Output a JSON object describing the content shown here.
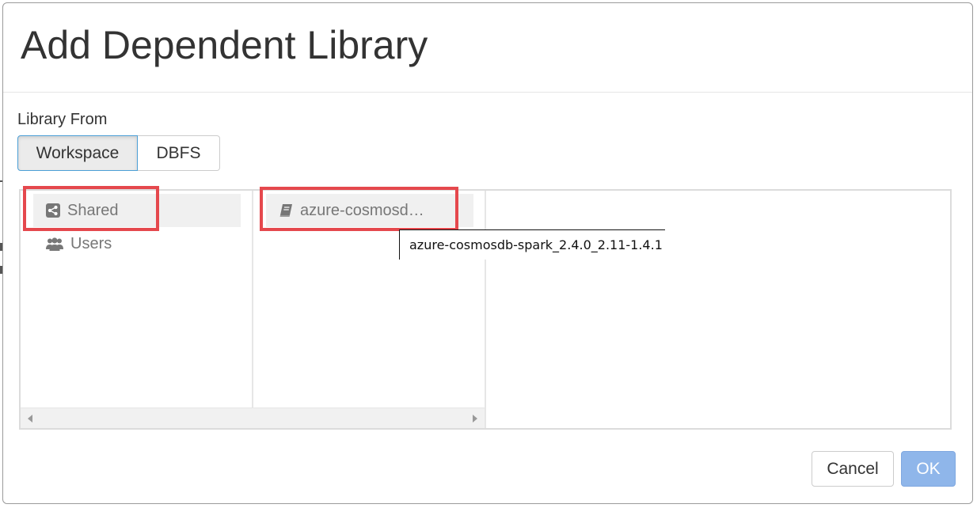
{
  "dialog": {
    "title": "Add Dependent Library",
    "library_from_label": "Library From"
  },
  "source_tabs": [
    {
      "label": "Workspace",
      "active": true
    },
    {
      "label": "DBFS",
      "active": false
    }
  ],
  "browser": {
    "folders": [
      {
        "label": "Shared",
        "icon": "share-icon",
        "selected": true
      },
      {
        "label": "Users",
        "icon": "users-icon",
        "selected": false
      }
    ],
    "files": [
      {
        "label": "azure-cosmosd…",
        "icon": "book-icon",
        "selected": true
      }
    ],
    "tooltip": "azure-cosmosdb-spark_2.4.0_2.11-1.4.1"
  },
  "footer": {
    "cancel_label": "Cancel",
    "ok_label": "OK"
  },
  "colors": {
    "highlight": "#e5484d",
    "ok_button": "#8fb6ea",
    "active_tab_border": "#4b9fd6"
  }
}
